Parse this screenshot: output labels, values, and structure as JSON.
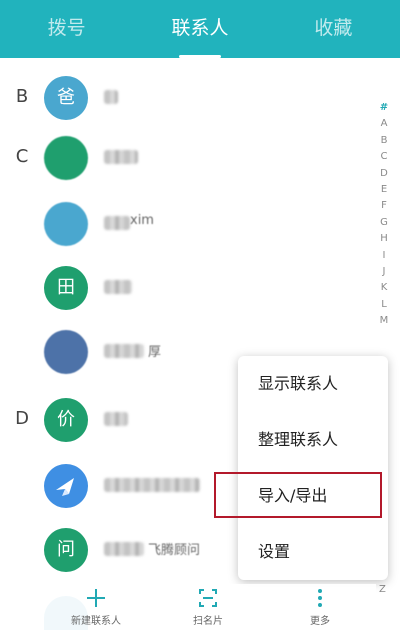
{
  "tabs": [
    {
      "label": "拨号",
      "active": false
    },
    {
      "label": "联系人",
      "active": true
    },
    {
      "label": "收藏",
      "active": false
    }
  ],
  "contacts": [
    {
      "section": "B",
      "avatar_text": "爸",
      "tone": "blue",
      "name_visible": ""
    },
    {
      "section": "C",
      "avatar_text": "",
      "tone": "green",
      "name_visible": ""
    },
    {
      "section": "",
      "avatar_text": "",
      "tone": "blue",
      "name_visible": "xim"
    },
    {
      "section": "",
      "avatar_text": "田",
      "tone": "green",
      "name_visible": ""
    },
    {
      "section": "",
      "avatar_text": "",
      "tone": "navy",
      "name_visible": "厚"
    },
    {
      "section": "D",
      "avatar_text": "价",
      "tone": "green",
      "name_visible": ""
    },
    {
      "section": "",
      "avatar_text": "",
      "tone": "bright",
      "name_visible": ""
    },
    {
      "section": "",
      "avatar_text": "问",
      "tone": "green",
      "name_visible": "飞腾顾问"
    }
  ],
  "index_letters": [
    "#",
    "A",
    "B",
    "C",
    "D",
    "E",
    "F",
    "G",
    "H",
    "I",
    "J",
    "K",
    "L",
    "M"
  ],
  "index_tail": "Z",
  "menu": {
    "items": [
      "显示联系人",
      "整理联系人",
      "导入/导出",
      "设置"
    ],
    "highlighted": "导入/导出"
  },
  "bottom_actions": [
    {
      "label": "新建联系人",
      "icon": "plus-icon"
    },
    {
      "label": "扫名片",
      "icon": "scan-card-icon"
    },
    {
      "label": "更多",
      "icon": "more-vertical-icon"
    }
  ],
  "colors": {
    "accent": "#21b3bd",
    "highlight_border": "#b3192b"
  }
}
